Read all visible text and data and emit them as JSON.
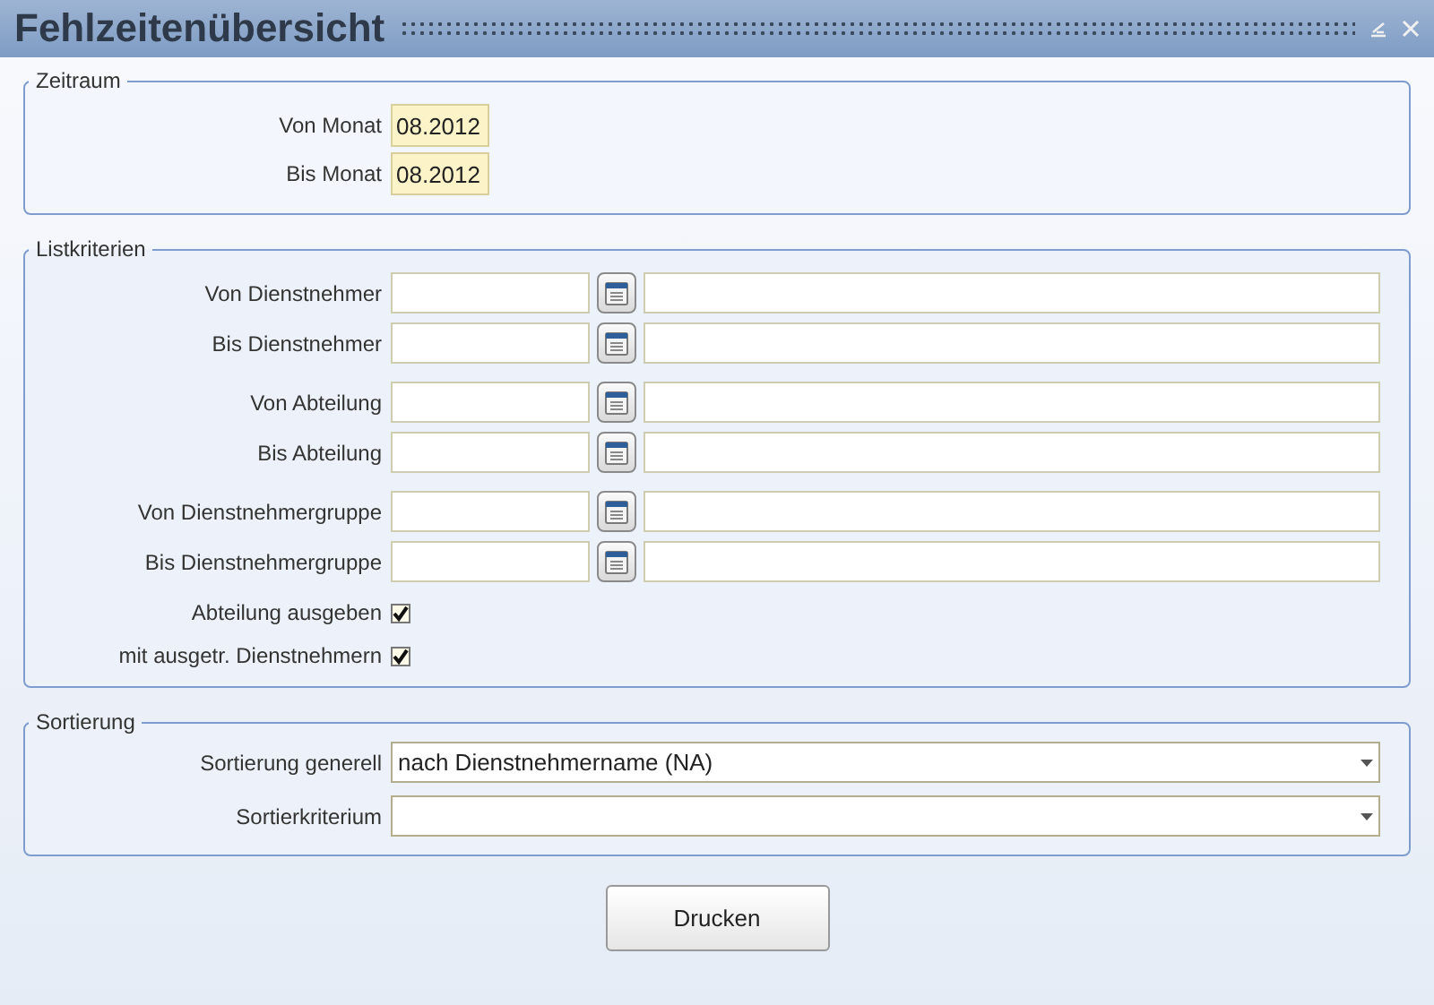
{
  "window": {
    "title": "Fehlzeitenübersicht"
  },
  "zeitraum": {
    "legend": "Zeitraum",
    "rows": [
      {
        "label": "Von Monat",
        "value": "08.2012"
      },
      {
        "label": "Bis Monat",
        "value": "08.2012"
      }
    ]
  },
  "listkriterien": {
    "legend": "Listkriterien",
    "groups": [
      [
        {
          "label": "Von Dienstnehmer"
        },
        {
          "label": "Bis Dienstnehmer"
        }
      ],
      [
        {
          "label": "Von Abteilung"
        },
        {
          "label": "Bis Abteilung"
        }
      ],
      [
        {
          "label": "Von Dienstnehmergruppe"
        },
        {
          "label": "Bis Dienstnehmergruppe"
        }
      ]
    ],
    "checkboxes": [
      {
        "label": "Abteilung ausgeben",
        "checked": true
      },
      {
        "label": "mit ausgetr. Dienstnehmern",
        "checked": true
      }
    ]
  },
  "sortierung": {
    "legend": "Sortierung",
    "rows": [
      {
        "label": "Sortierung generell",
        "value": "nach Dienstnehmername (NA)"
      },
      {
        "label": "Sortierkriterium"
      }
    ]
  },
  "buttons": [
    "Drucken"
  ]
}
